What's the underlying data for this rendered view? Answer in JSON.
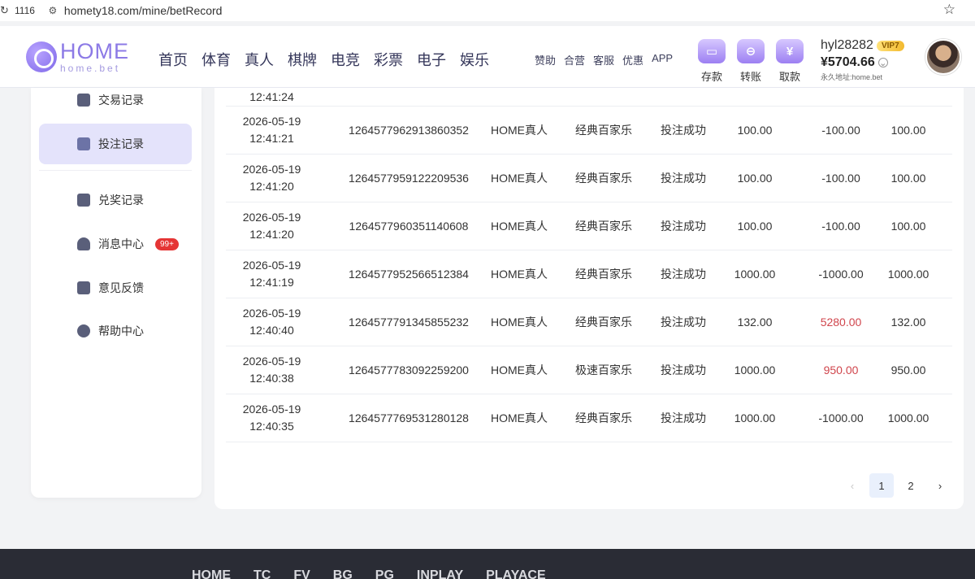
{
  "browser": {
    "tab_count": "1116",
    "url": "homety18.com/mine/betRecord"
  },
  "header": {
    "logo_text": "HOME",
    "logo_sub": "home.bet",
    "nav": [
      "首页",
      "体育",
      "真人",
      "棋牌",
      "电竞",
      "彩票",
      "电子",
      "娱乐"
    ],
    "sub_nav": [
      "赞助",
      "合营",
      "客服",
      "优惠",
      "APP"
    ],
    "wallet": [
      {
        "label": "存款",
        "icon": "deposit-icon"
      },
      {
        "label": "转账",
        "icon": "transfer-icon"
      },
      {
        "label": "取款",
        "icon": "withdraw-icon"
      }
    ],
    "user": {
      "name": "hyl28282",
      "vip": "VIP7",
      "balance": "¥5704.66",
      "permanent": "永久地址:home.bet"
    }
  },
  "sidebar": {
    "items": [
      {
        "label": "交易记录",
        "icon": "wallet-icon"
      },
      {
        "label": "投注记录",
        "icon": "bet-record-icon",
        "active": true
      },
      {
        "label": "兑奖记录",
        "icon": "gift-icon"
      },
      {
        "label": "消息中心",
        "icon": "bell-icon",
        "badge": "99+"
      },
      {
        "label": "意见反馈",
        "icon": "feedback-icon"
      },
      {
        "label": "帮助中心",
        "icon": "bulb-icon"
      }
    ]
  },
  "table": {
    "partial_time": "12:41:24",
    "rows": [
      {
        "date": "2026-05-19",
        "time": "12:41:21",
        "id": "1264577962913860352",
        "platform": "HOME真人",
        "game": "经典百家乐",
        "status": "投注成功",
        "bet": "100.00",
        "win": "-100.00",
        "valid": "100.00"
      },
      {
        "date": "2026-05-19",
        "time": "12:41:20",
        "id": "1264577959122209536",
        "platform": "HOME真人",
        "game": "经典百家乐",
        "status": "投注成功",
        "bet": "100.00",
        "win": "-100.00",
        "valid": "100.00"
      },
      {
        "date": "2026-05-19",
        "time": "12:41:20",
        "id": "1264577960351140608",
        "platform": "HOME真人",
        "game": "经典百家乐",
        "status": "投注成功",
        "bet": "100.00",
        "win": "-100.00",
        "valid": "100.00"
      },
      {
        "date": "2026-05-19",
        "time": "12:41:19",
        "id": "1264577952566512384",
        "platform": "HOME真人",
        "game": "经典百家乐",
        "status": "投注成功",
        "bet": "1000.00",
        "win": "-1000.00",
        "valid": "1000.00"
      },
      {
        "date": "2026-05-19",
        "time": "12:40:40",
        "id": "1264577791345855232",
        "platform": "HOME真人",
        "game": "经典百家乐",
        "status": "投注成功",
        "bet": "132.00",
        "win": "5280.00",
        "valid": "132.00",
        "positive": true
      },
      {
        "date": "2026-05-19",
        "time": "12:40:38",
        "id": "1264577783092259200",
        "platform": "HOME真人",
        "game": "极速百家乐",
        "status": "投注成功",
        "bet": "1000.00",
        "win": "950.00",
        "valid": "950.00",
        "positive": true
      },
      {
        "date": "2026-05-19",
        "time": "12:40:35",
        "id": "1264577769531280128",
        "platform": "HOME真人",
        "game": "经典百家乐",
        "status": "投注成功",
        "bet": "1000.00",
        "win": "-1000.00",
        "valid": "1000.00"
      }
    ]
  },
  "pagination": {
    "prev": "‹",
    "pages": [
      "1",
      "2"
    ],
    "current": "1",
    "next": "›"
  },
  "footer": {
    "partners": [
      "HOME",
      "TC",
      "FV",
      "BG",
      "PG",
      "INPLAY",
      "PLAYACE"
    ]
  },
  "colors": {
    "accent": "#8c7ae6",
    "positive_win": "#d0454c",
    "active_bg": "#e4e3fb"
  }
}
